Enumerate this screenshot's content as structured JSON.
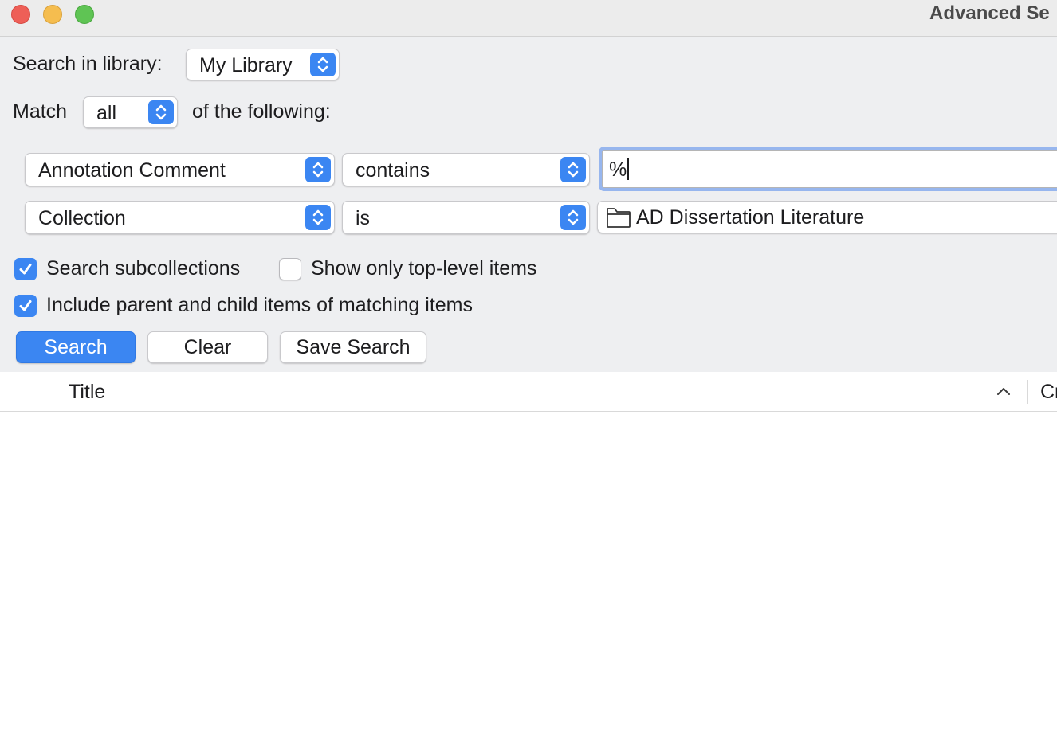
{
  "window": {
    "title": "Advanced Se"
  },
  "library": {
    "label": "Search in library:",
    "selected": "My Library"
  },
  "match": {
    "label_before": "Match",
    "selected": "all",
    "label_after": "of the following:"
  },
  "conditions": [
    {
      "field": "Annotation Comment",
      "operator": "contains",
      "value": "%"
    },
    {
      "field": "Collection",
      "operator": "is",
      "value": "AD Dissertation Literature"
    }
  ],
  "options": {
    "search_subcollections": {
      "label": "Search subcollections",
      "checked": true
    },
    "show_top_level": {
      "label": "Show only top-level items",
      "checked": false
    },
    "include_parent_child": {
      "label": "Include parent and child items of matching items",
      "checked": true
    }
  },
  "buttons": {
    "search": "Search",
    "clear": "Clear",
    "save_search": "Save Search"
  },
  "results": {
    "columns": [
      "Title",
      "Cr"
    ]
  },
  "colors": {
    "accent": "#3b86f2",
    "panel_background": "#eeeff1",
    "focus_ring": "#97b6ee"
  }
}
